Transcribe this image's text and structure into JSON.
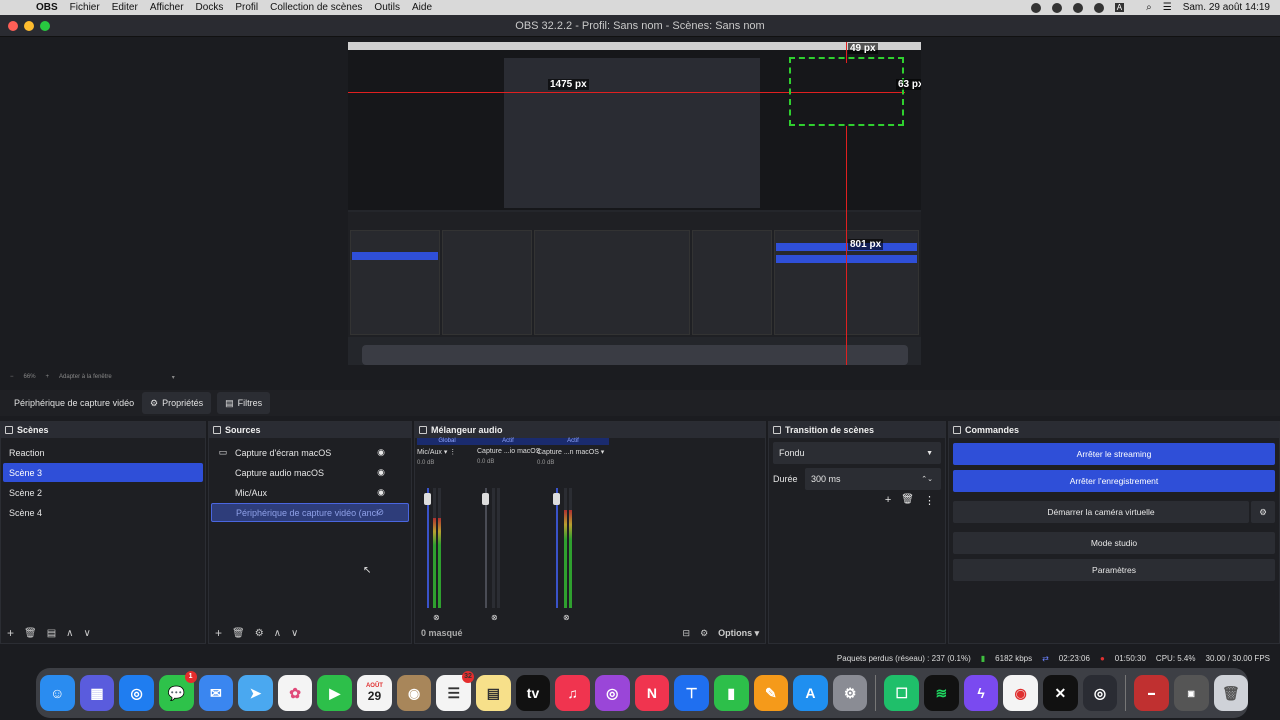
{
  "menubar": {
    "items": [
      "OBS",
      "Fichier",
      "Editer",
      "Afficher",
      "Docks",
      "Profil",
      "Collection de scènes",
      "Outils",
      "Aide"
    ],
    "datetime": "Sam. 29 août 14:19",
    "input_indicator": "A"
  },
  "window": {
    "title": "OBS 32.2.2 - Profil: Sans nom - Scènes: Sans nom"
  },
  "preview": {
    "measure_top": "49 px",
    "measure_left": "1475 px",
    "measure_right": "63 px",
    "measure_bottom": "801 px"
  },
  "zoom": {
    "level": "66%",
    "fit_label": "Adapter à la fenêtre"
  },
  "toolbar": {
    "device_label": "Périphérique de capture vidéo",
    "properties_label": "Propriétés",
    "filters_label": "Filtres"
  },
  "scenes": {
    "title": "Scènes",
    "items": [
      "Reaction",
      "Scène 3",
      "Scène 2",
      "Scène 4"
    ],
    "selected": "Scène 3"
  },
  "sources": {
    "title": "Sources",
    "items": [
      {
        "label": "Capture d'écran macOS",
        "icon": "monitor-icon"
      },
      {
        "label": "Capture audio macOS",
        "icon": "speaker-icon"
      },
      {
        "label": "Mic/Aux",
        "icon": "microphone-icon"
      },
      {
        "label": "Périphérique de capture vidéo (ancien",
        "icon": "camera-icon"
      }
    ]
  },
  "mixer": {
    "title": "Mélangeur audio",
    "channels": [
      {
        "top": "Global",
        "name": "Mic/Aux",
        "db": "0.0 dB",
        "level": 0.75,
        "muted": false
      },
      {
        "top": "Actif",
        "name": "Capture ...io macOS",
        "db": "0.0 dB",
        "level": 0.0,
        "muted": true
      },
      {
        "top": "Actif",
        "name": "Capture ...n macOS",
        "db": "0.0 dB",
        "level": 0.82,
        "muted": false
      }
    ],
    "hidden_label": "0 masqué",
    "options_label": "Options",
    "scale": [
      "0",
      "-6",
      "-12",
      "-18",
      "-24",
      "-30",
      "-36",
      "-42",
      "-48",
      "-54",
      "-60"
    ]
  },
  "transition": {
    "title": "Transition de scènes",
    "type": "Fondu",
    "duration_label": "Durée",
    "duration_value": "300 ms"
  },
  "commands": {
    "title": "Commandes",
    "stop_streaming": "Arrêter le streaming",
    "stop_recording": "Arrêter l'enregistrement",
    "virtual_cam": "Démarrer la caméra virtuelle",
    "studio_mode": "Mode studio",
    "settings": "Paramètres"
  },
  "status": {
    "dropped": "Paquets perdus (réseau) : 237 (0.1%)",
    "bitrate": "6182 kbps",
    "stream_time": "02:23:06",
    "rec_time": "01:50:30",
    "cpu": "CPU: 5.4%",
    "fps": "30.00 / 30.00 FPS"
  },
  "dock": {
    "calendar_month": "AOÛT",
    "calendar_day": "29",
    "messages_badge": "1",
    "reminders_badge": "32"
  }
}
